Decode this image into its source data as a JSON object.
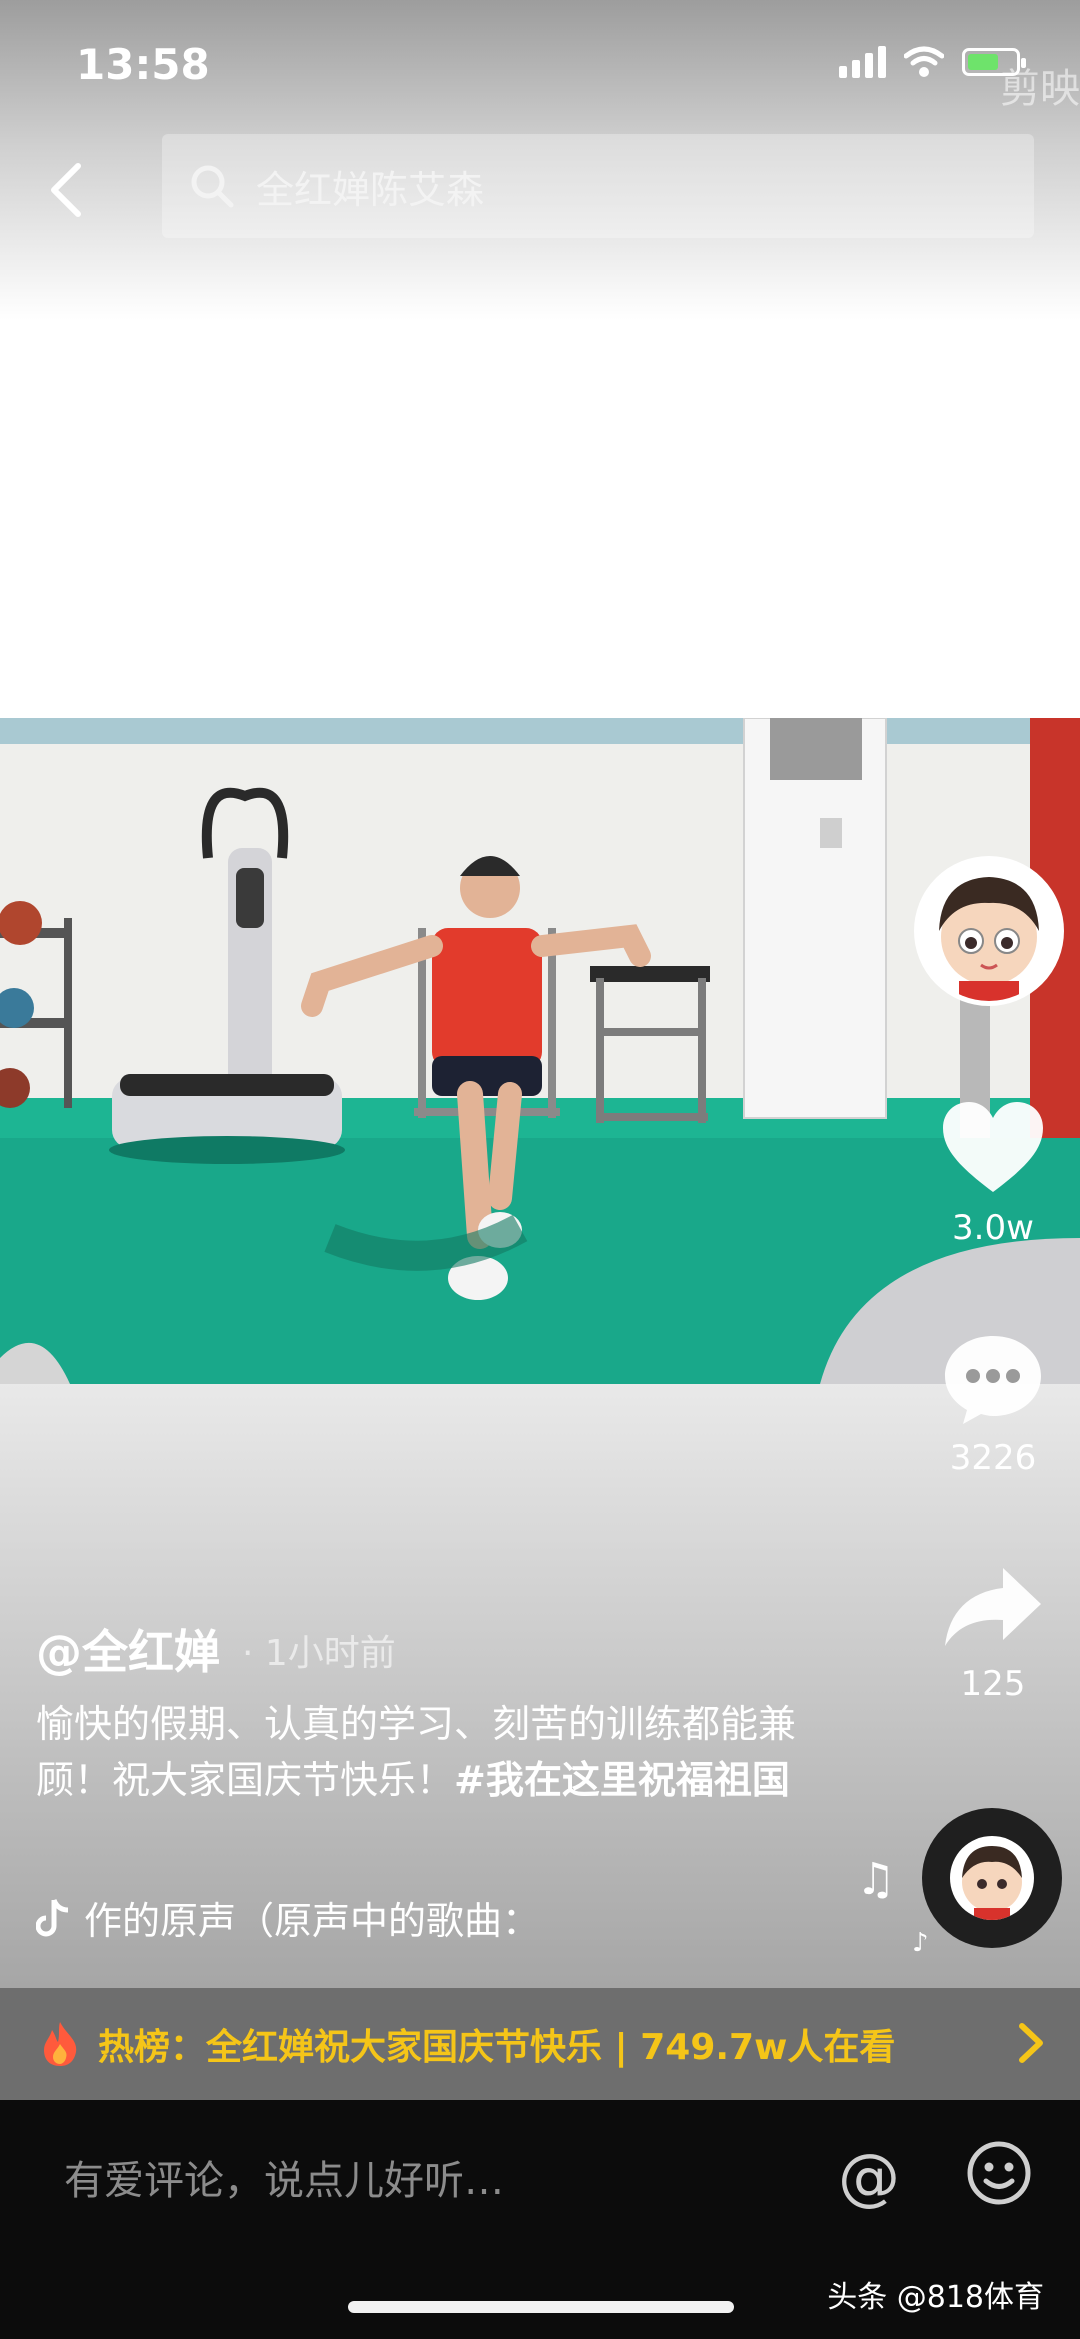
{
  "status_bar": {
    "time": "13:58",
    "corner_watermark": "剪映"
  },
  "header": {
    "search_text": "全红婵陈艾森"
  },
  "actions": {
    "likes": "3.0w",
    "comments": "3226",
    "shares": "125"
  },
  "post": {
    "author": "@全红婵",
    "time_ago": "· 1小时前",
    "caption_text": "愉快的假期、认真的学习、刻苦的训练都能兼顾！祝大家国庆节快乐！",
    "caption_tag": "#我在这里祝福祖国",
    "music": "作的原声（原声中的歌曲："
  },
  "hot_list": {
    "text": "热榜：全红婵祝大家国庆节快乐 | 749.7w人在看"
  },
  "comment_bar": {
    "placeholder": "有爱评论，说点儿好听…",
    "at_symbol": "@"
  },
  "watermark": "头条 @818体育",
  "colors": {
    "hot_text": "#f5c518",
    "comment_bg": "#0c0c0c",
    "floor_green": "#19a88a"
  }
}
